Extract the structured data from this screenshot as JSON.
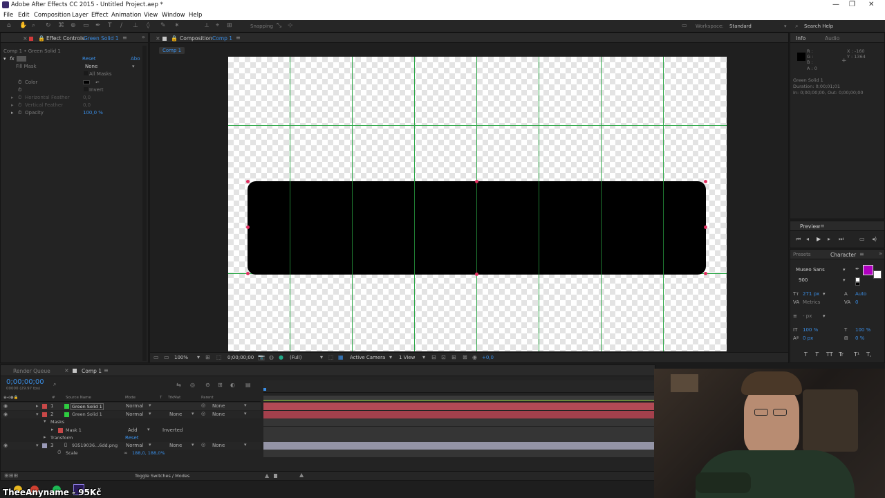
{
  "window": {
    "title": "Adobe After Effects CC 2015 - Untitled Project.aep *"
  },
  "menu": [
    "File",
    "Edit",
    "Composition",
    "Layer",
    "Effect",
    "Animation",
    "View",
    "Window",
    "Help"
  ],
  "toolbar": {
    "snapping": "Snapping",
    "workspace_label": "Workspace:",
    "workspace_value": "Standard",
    "search_placeholder": "Search Help"
  },
  "effect_controls": {
    "tab_label": "Effect Controls",
    "tab_layer": "Green Solid 1",
    "breadcrumb": "Comp 1 • Green Solid 1",
    "reset": "Reset",
    "about": "Abo",
    "fill_mask_label": "Fill Mask",
    "fill_mask_value": "None",
    "all_masks": "All Masks",
    "color_label": "Color",
    "invert_label": "Invert",
    "horizontal_feather_label": "Horizontal Feather",
    "horizontal_feather_value": "0,0",
    "vertical_feather_label": "Vertical Feather",
    "vertical_feather_value": "0,0",
    "opacity_label": "Opacity",
    "opacity_value": "100,0 %"
  },
  "composition": {
    "tab_label": "Composition",
    "tab_comp": "Comp 1",
    "subtab": "Comp 1",
    "zoom": "100%",
    "timecode": "0;00;00;00",
    "resolution": "(Full)",
    "camera": "Active Camera",
    "views": "1 View",
    "exposure": "+0,0"
  },
  "info": {
    "tab_info": "Info",
    "tab_audio": "Audio",
    "r": "R :",
    "g": "G :",
    "b": "B :",
    "a": "A : 0",
    "x": "X : -160",
    "y": "Y : 1364",
    "layer_name": "Green Solid 1",
    "duration": "Duration: 0;00;01;01",
    "in_out": "In: 0;00;00;00, Out: 0;00;00;00"
  },
  "preview": {
    "tab": "Preview"
  },
  "character": {
    "tab_presets": "Presets",
    "tab": "Character",
    "font": "Museo Sans",
    "weight": "900",
    "size": "271 px",
    "leading": "Auto",
    "kerning": "Metrics",
    "tracking": "0",
    "stroke": "- px",
    "vscale": "100 %",
    "hscale": "100 %",
    "baseline": "0 px",
    "tsume": "0 %",
    "fill_color": "#b000c0",
    "style_buttons": [
      "T",
      "T",
      "TT",
      "Tr",
      "T¹",
      "T,"
    ]
  },
  "timeline": {
    "tab_render": "Render Queue",
    "tab_comp": "Comp 1",
    "timecode": "0;00;00;00",
    "fps": "00000 (29.97 fps)",
    "col_num": "#",
    "col_source": "Source Name",
    "col_mode": "Mode",
    "col_t": "T",
    "col_trkmat": "TrkMat",
    "col_parent": "Parent",
    "layers": [
      {
        "num": "1",
        "name": "Green Solid 1",
        "mode": "Normal",
        "trkmat": "",
        "parent": "None",
        "color": "#2ecc40"
      },
      {
        "num": "2",
        "name": "Green Solid 1",
        "mode": "Normal",
        "trkmat": "None",
        "parent": "None",
        "color": "#2ecc40"
      },
      {
        "num": "3",
        "name": "93519036...6dd.png",
        "mode": "Normal",
        "trkmat": "None",
        "parent": "None",
        "color": "#9a9ab8"
      }
    ],
    "masks_label": "Masks",
    "mask1_label": "Mask 1",
    "mask1_mode": "Add",
    "mask1_inverted": "Inverted",
    "transform_label": "Transform",
    "transform_reset": "Reset",
    "scale_label": "Scale",
    "scale_value": "188,0, 188,0%",
    "toggle_label": "Toggle Switches / Modes"
  },
  "overlay": {
    "stream_text": "TheeAnyname - 95Kč"
  }
}
